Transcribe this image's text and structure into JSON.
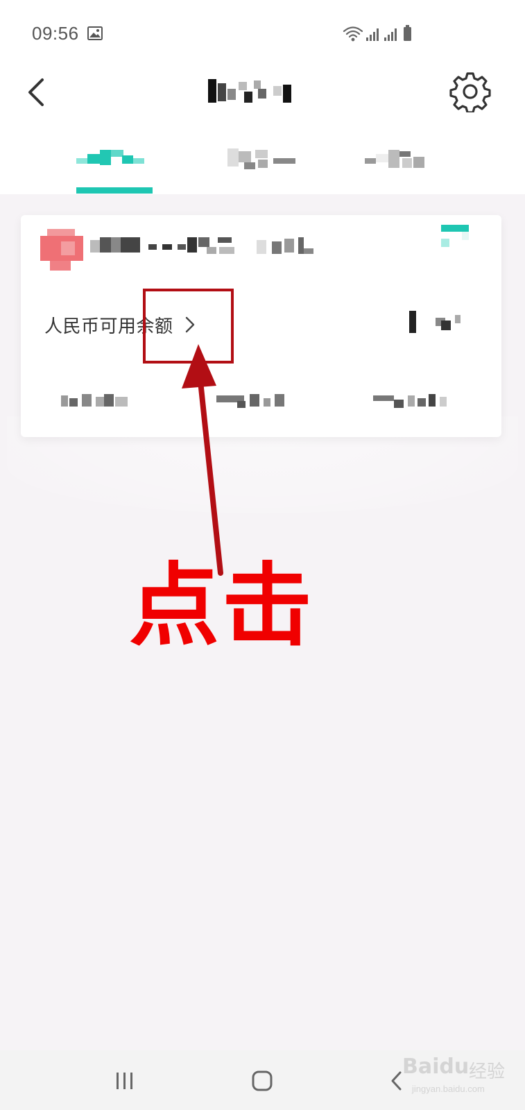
{
  "status_bar": {
    "time": "09:56",
    "icons": [
      "gallery-icon",
      "wifi-icon",
      "signal-icon",
      "signal-icon",
      "battery-icon"
    ]
  },
  "header": {
    "back_icon": "chevron-left-icon",
    "settings_icon": "gear-icon"
  },
  "tabs": {
    "active_index": 0,
    "accent_color": "#1ec6b2"
  },
  "card": {
    "balance_label": "人民币可用余额",
    "balance_chevron_icon": "chevron-right-icon"
  },
  "annotation": {
    "instruction": "点击",
    "color": "#f00000",
    "box_color": "#b20e14"
  },
  "nav_bar": {
    "icons": [
      "recent-apps-icon",
      "home-icon",
      "back-icon"
    ]
  },
  "watermark": {
    "brand": "Baidu",
    "cn": "经验",
    "url": "jingyan.baidu.com"
  }
}
